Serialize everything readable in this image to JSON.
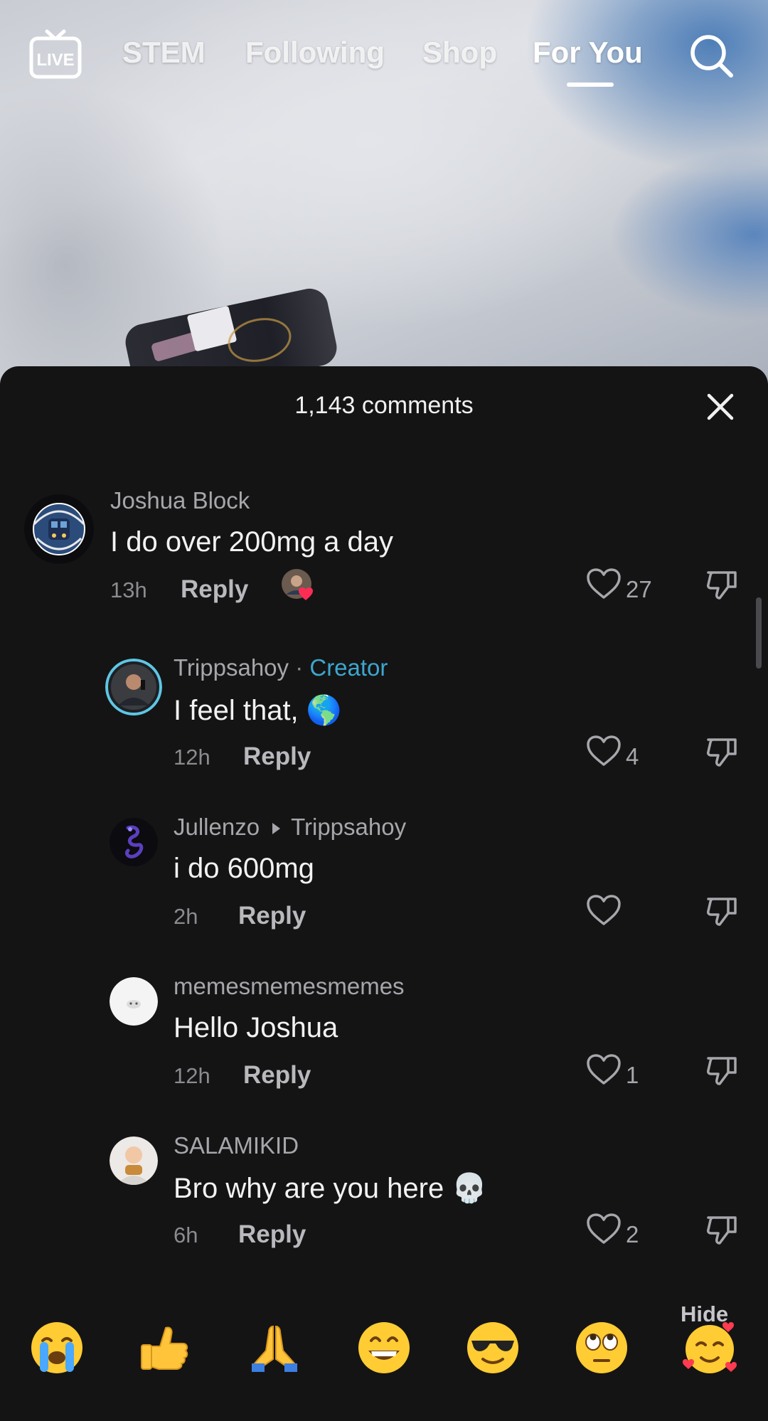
{
  "nav": {
    "live_label": "LIVE",
    "tabs": [
      {
        "label": "STEM"
      },
      {
        "label": "Following"
      },
      {
        "label": "Shop"
      },
      {
        "label": "For You",
        "active": true
      }
    ]
  },
  "comments_panel": {
    "title": "1,143 comments",
    "hide_label": "Hide",
    "comments": [
      {
        "user": "Joshua Block",
        "text": "I do over 200mg a day",
        "time": "13h",
        "reply_label": "Reply",
        "likes": "27",
        "creator_liked": true
      },
      {
        "user": "Trippsahoy",
        "badge_separator": " · ",
        "badge": "Creator",
        "text": "I feel that, 🌎",
        "time": "12h",
        "reply_label": "Reply",
        "likes": "4"
      },
      {
        "user": "Jullenzo",
        "replying_to": "Trippsahoy",
        "text": "i do 600mg",
        "time": "2h",
        "reply_label": "Reply",
        "likes": ""
      },
      {
        "user": "memesmemesmemes",
        "text": "Hello Joshua",
        "time": "12h",
        "reply_label": "Reply",
        "likes": "1"
      },
      {
        "user": "SALAMIKID",
        "text": "Bro why are you here 💀",
        "time": "6h",
        "reply_label": "Reply",
        "likes": "2"
      }
    ]
  },
  "emoji_bar": [
    "😭",
    "👍",
    "🙏",
    "😁",
    "😎",
    "🙄",
    "🥰"
  ],
  "colors": {
    "background": "#141415",
    "creator_badge": "#3ea6cd",
    "heart_red": "#fe2c55"
  }
}
